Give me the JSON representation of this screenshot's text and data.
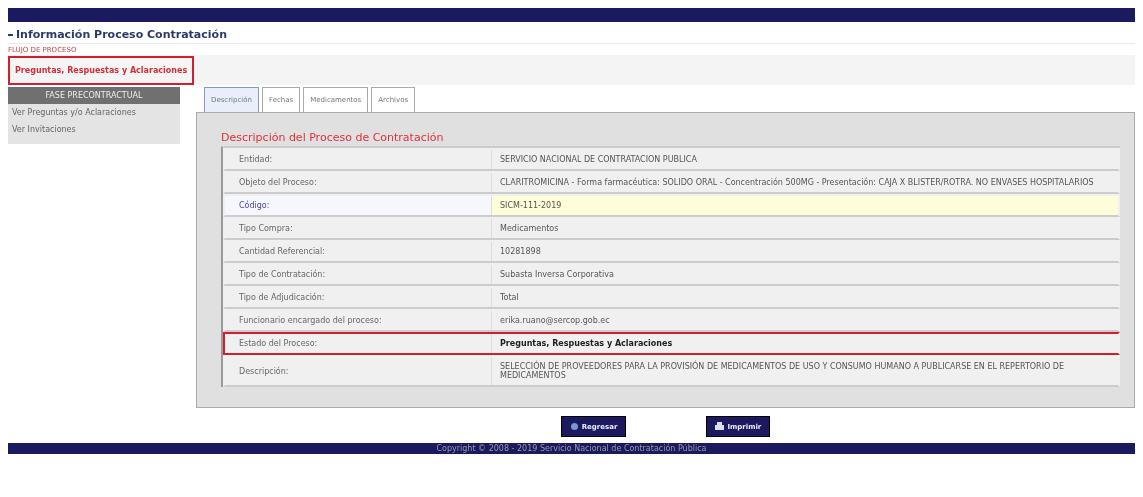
{
  "page_title": "Información Proceso Contratación",
  "flow": {
    "label": "FLUJO DE PROCESO",
    "stage": "Preguntas, Respuestas y Aclaraciones",
    "annotated": true
  },
  "sidebar": {
    "header": "FASE PRECONTRACTUAL",
    "items": [
      {
        "label": "Ver Preguntas y/o Aclaraciones"
      },
      {
        "label": "Ver Invitaciones"
      }
    ]
  },
  "tabs": [
    {
      "label": "Descripción",
      "selected": true
    },
    {
      "label": "Fechas",
      "selected": false
    },
    {
      "label": "Medicamentos",
      "selected": false
    },
    {
      "label": "Archivos",
      "selected": false
    }
  ],
  "section_title": "Descripción del Proceso de Contratación",
  "rows": [
    {
      "label": "Entidad:",
      "value": "SERVICIO NACIONAL DE CONTRATACION PUBLICA",
      "selected": false,
      "annotated": false,
      "bold": false
    },
    {
      "label": "Objeto del Proceso:",
      "value": "CLARITROMICINA - Forma farmacéutica: SOLIDO ORAL - Concentración 500MG - Presentación: CAJA X BLISTER/ROTRA. NO ENVASES HOSPITALARIOS",
      "selected": false,
      "annotated": false,
      "bold": false
    },
    {
      "label": "Código:",
      "value": "SICM-111-2019",
      "selected": true,
      "annotated": false,
      "bold": false
    },
    {
      "label": "Tipo Compra:",
      "value": "Medicamentos",
      "selected": false,
      "annotated": false,
      "bold": false
    },
    {
      "label": "Cantidad Referencial:",
      "value": "10281898",
      "selected": false,
      "annotated": false,
      "bold": false
    },
    {
      "label": "Tipo de Contratación:",
      "value": "Subasta Inversa Corporativa",
      "selected": false,
      "annotated": false,
      "bold": false
    },
    {
      "label": "Tipo de Adjudicación:",
      "value": "Total",
      "selected": false,
      "annotated": false,
      "bold": false
    },
    {
      "label": "Funcionario encargado del proceso:",
      "value": "erika.ruano@sercop.gob.ec",
      "selected": false,
      "annotated": false,
      "bold": false
    },
    {
      "label": "Estado del Proceso:",
      "value": "Preguntas, Respuestas y Aclaraciones",
      "selected": false,
      "annotated": true,
      "bold": true
    },
    {
      "label": "Descripción:",
      "value": "SELECCIÓN DE PROVEEDORES PARA LA PROVISIÓN DE MEDICAMENTOS DE USO Y CONSUMO HUMANO A PUBLICARSE EN EL REPERTORIO DE MEDICAMENTOS",
      "selected": false,
      "annotated": false,
      "bold": false
    }
  ],
  "buttons": [
    {
      "label": "Regresar",
      "kind": "back"
    },
    {
      "label": "Imprimir",
      "kind": "print"
    }
  ],
  "footer": "Copyright © 2008 - 2019 Servicio Nacional de Contratación Pública"
}
